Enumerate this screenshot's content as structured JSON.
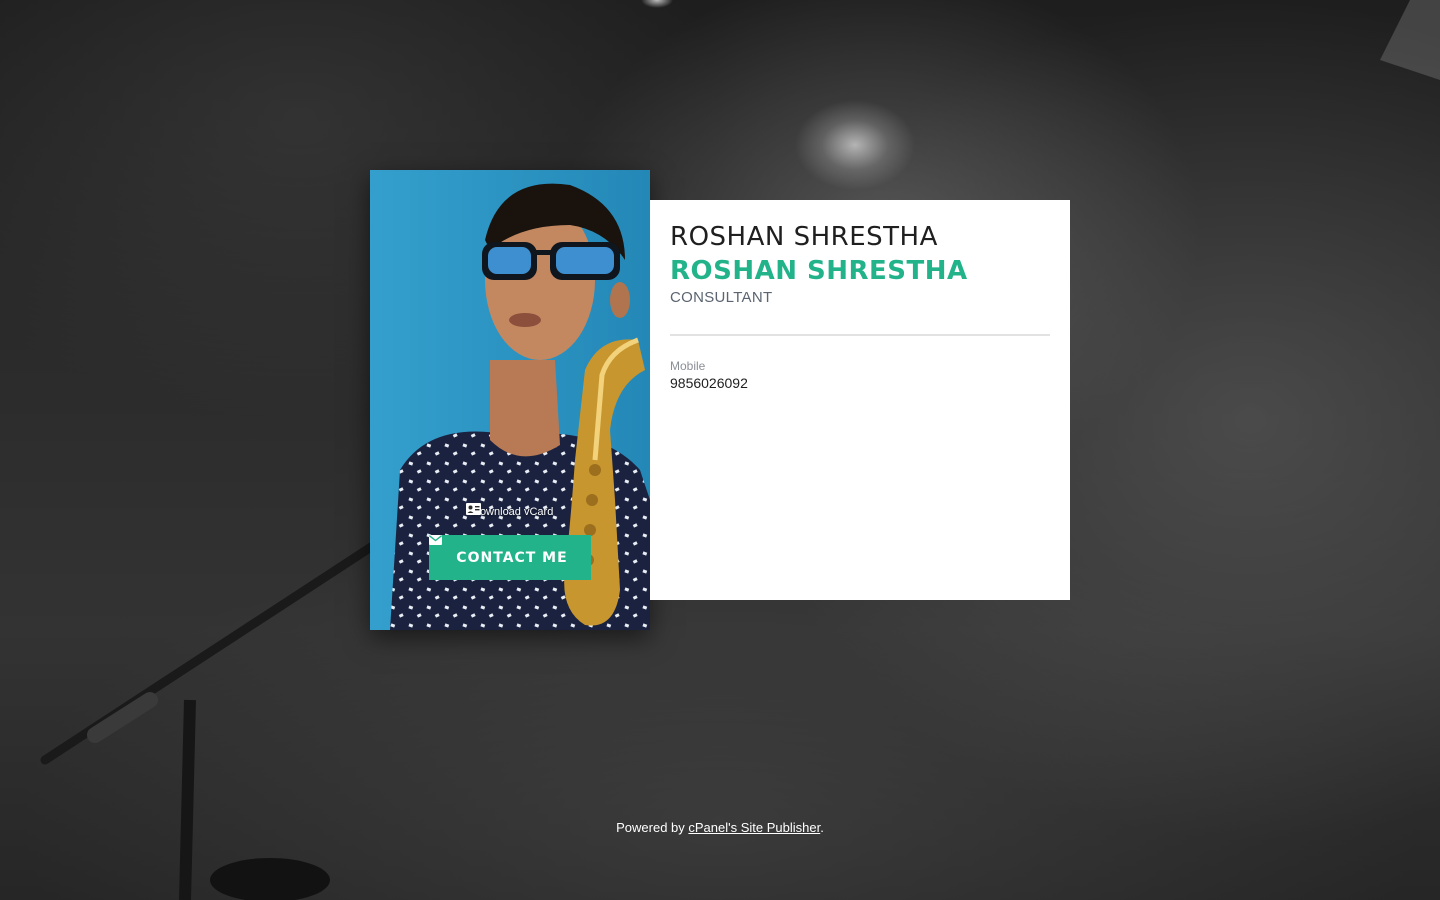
{
  "profile": {
    "name": "ROSHAN SHRESTHA",
    "name_secondary": "ROSHAN SHRESTHA",
    "title": "CONSULTANT"
  },
  "fields": [
    {
      "label": "Mobile",
      "value": "9856026092"
    }
  ],
  "actions": {
    "vcard_label": "Download vCard",
    "vcard_icon": "contact-card-icon",
    "contact_label": "CONTACT ME",
    "contact_icon": "envelope-icon"
  },
  "footer": {
    "prefix": "Powered by",
    "link_text": "cPanel's Site Publisher",
    "suffix": "."
  },
  "colors": {
    "accent": "#22b38a",
    "background": "#2a2a2a",
    "card": "#ffffff",
    "photo_backdrop": "#2b95c4"
  }
}
